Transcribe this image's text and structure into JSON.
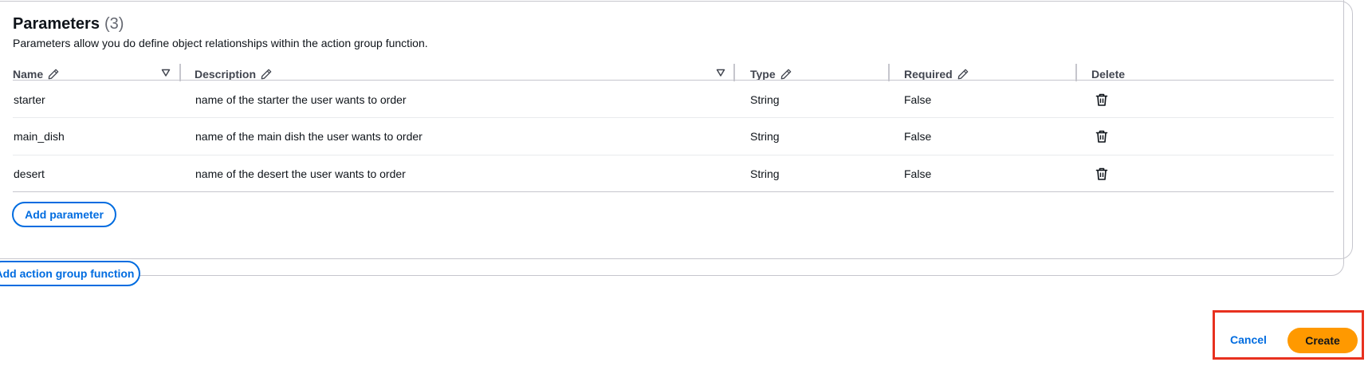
{
  "params": {
    "title": "Parameters",
    "count": "(3)",
    "description": "Parameters allow you do define object relationships within the action group function."
  },
  "table": {
    "headers": {
      "name": "Name",
      "description": "Description",
      "type": "Type",
      "required": "Required",
      "delete": "Delete"
    },
    "rows": [
      {
        "name": "starter",
        "description": "name of the starter the user wants to order",
        "type": "String",
        "required": "False"
      },
      {
        "name": "main_dish",
        "description": "name of the main dish the user wants to order",
        "type": "String",
        "required": "False"
      },
      {
        "name": "desert",
        "description": "name of the desert the user wants to order",
        "type": "String",
        "required": "False"
      }
    ]
  },
  "buttons": {
    "add_parameter": "Add parameter",
    "add_action_group_function": "Add action group function",
    "cancel": "Cancel",
    "create": "Create"
  },
  "icons": {
    "edit": "pencil-icon",
    "sort": "sort-descending-icon",
    "delete": "trash-icon"
  },
  "colors": {
    "primary": "#006ce0",
    "create": "#ff9900",
    "highlight": "#e8311f",
    "border": "#c6c6cd"
  }
}
